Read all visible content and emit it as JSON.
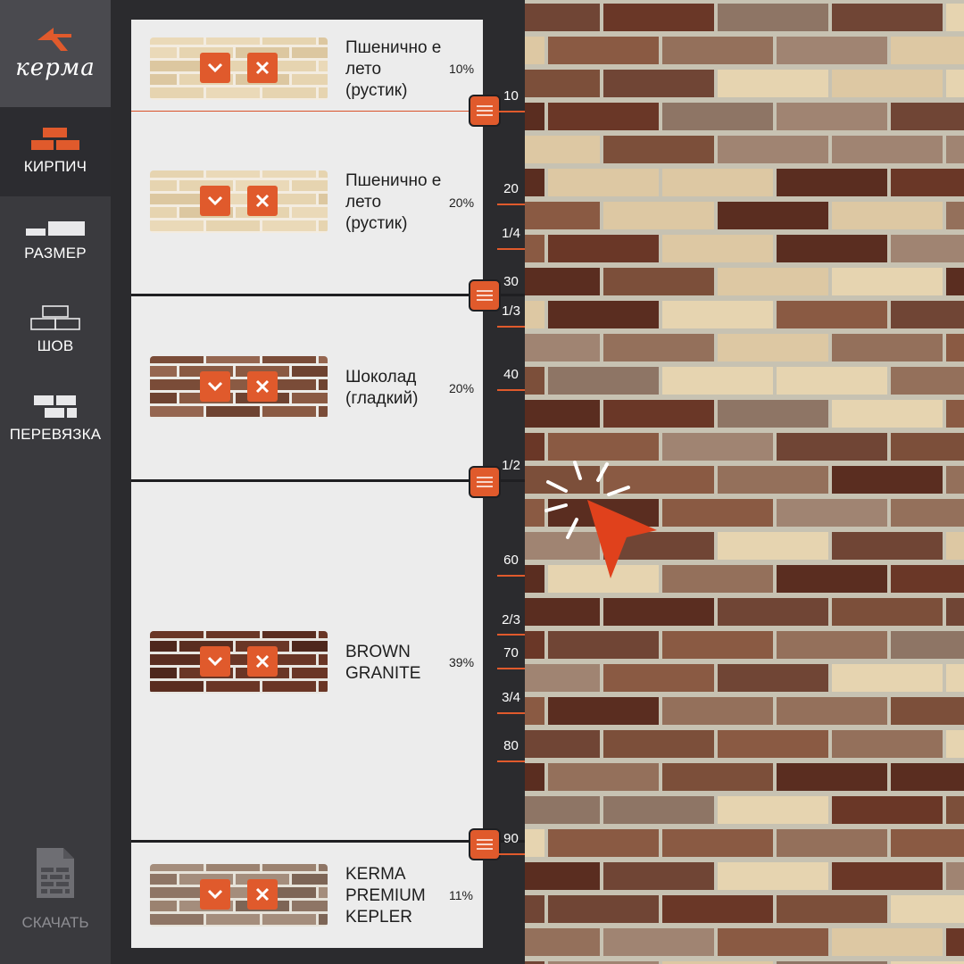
{
  "logo": {
    "text": "керма"
  },
  "sidebar": {
    "items": [
      {
        "label": "КИРПИЧ",
        "icon": "bricks-icon",
        "active": true
      },
      {
        "label": "РАЗМЕР",
        "icon": "brick-size-icon",
        "active": false
      },
      {
        "label": "ШОВ",
        "icon": "brick-joint-icon",
        "active": false
      },
      {
        "label": "ПЕРЕВЯЗКА",
        "icon": "brick-bond-icon",
        "active": false
      }
    ],
    "download_label": "СКАЧАТЬ",
    "download_icon": "brick-document-icon"
  },
  "bricks": [
    {
      "name": "Пшенично е лето (рустик)",
      "percent": "10%",
      "texture": "wheat"
    },
    {
      "name": "Пшенично е лето (рустик)",
      "percent": "20%",
      "texture": "wheat"
    },
    {
      "name": "Шоколад (гладкий)",
      "percent": "20%",
      "texture": "chocolate"
    },
    {
      "name": "BROWN GRANITE",
      "percent": "39%",
      "texture": "granite"
    },
    {
      "name": "KERMA PREMIUM KEPLER",
      "percent": "11%",
      "texture": "kepler"
    }
  ],
  "ruler": [
    "10",
    "20",
    "1/4",
    "30",
    "1/3",
    "40",
    "1/2",
    "60",
    "2/3",
    "70",
    "3/4",
    "80",
    "90"
  ],
  "colors": {
    "accent": "#e05a2c",
    "sidebar_bg": "#3a3a3e",
    "active_nav_bg": "#2c2c30",
    "panel_bg": "#ececec",
    "wheat": "#e6d4b0",
    "chocolate": "#8a5a43",
    "granite": "#5a2d20",
    "kepler": "#8e7565",
    "mortar": "#c7c2b2"
  }
}
